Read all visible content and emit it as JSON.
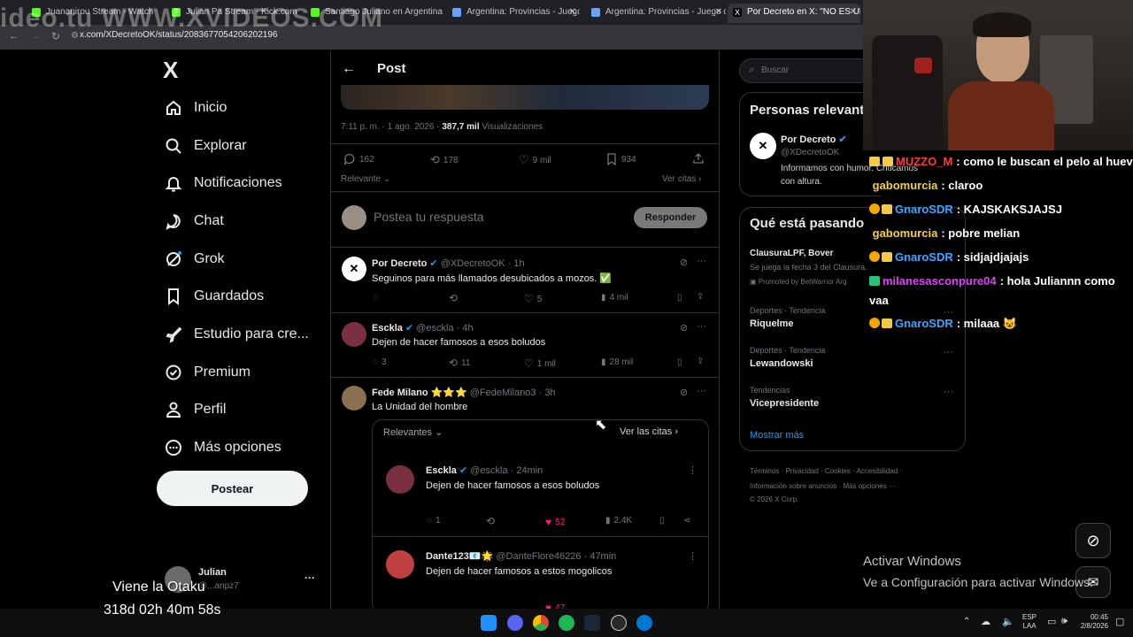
{
  "browser": {
    "watermark": "ideo.tu WWW.XVIDEOS.COM",
    "tabs": [
      {
        "label": "Juananirou Stream - Watch",
        "color": "#53fc18"
      },
      {
        "label": "Julian Pa Stream - Kick.com",
        "color": "#53fc18"
      },
      {
        "label": "Santiago Juliano en Argentina",
        "color": "#53fc18"
      },
      {
        "label": "Argentina: Provincias - Juego d",
        "color": "#6aa3ff"
      },
      {
        "label": "Argentina: Provincias - Juego d",
        "color": "#6aa3ff"
      },
      {
        "label": "Por Decreto en X: \"NO ES UN",
        "color": "#ffffff"
      }
    ],
    "url": "x.com/XDecretoOK/status/2083677054206202196"
  },
  "nav": {
    "logo": "X",
    "items": [
      {
        "label": "Inicio",
        "icon": "home-icon"
      },
      {
        "label": "Explorar",
        "icon": "search-icon"
      },
      {
        "label": "Notificaciones",
        "icon": "bell-icon"
      },
      {
        "label": "Chat",
        "icon": "chat-icon"
      },
      {
        "label": "Grok",
        "icon": "grok-icon"
      },
      {
        "label": "Guardados",
        "icon": "bookmark-icon"
      },
      {
        "label": "Estudio para cre...",
        "icon": "rocket-icon"
      },
      {
        "label": "Premium",
        "icon": "premium-icon"
      },
      {
        "label": "Perfil",
        "icon": "person-icon"
      },
      {
        "label": "Más opciones",
        "icon": "more-icon"
      }
    ],
    "post_button": "Postear",
    "account_name": "Julian",
    "account_handle": "@...anpz7",
    "more": "···"
  },
  "post": {
    "header_title": "Post",
    "timestamp": "7:11 p. m. · 1 ago. 2026 ·",
    "views_count": "387,7 mil",
    "views_label": "Visualizaciones",
    "replies": "162",
    "reposts": "178",
    "likes": "9 mil",
    "bookmarks": "934",
    "sort_label": "Relevante",
    "quotes_link": "Ver citas",
    "reply_placeholder": "Postea tu respuesta",
    "reply_button": "Responder"
  },
  "replies": [
    {
      "name": "Por Decreto",
      "handle": "@XDecretoOK · 1h",
      "text": "Seguinos para más llamados desubicados a mozos. ✅",
      "replies": "",
      "reposts": "",
      "likes": "5",
      "views": "4 mil"
    },
    {
      "name": "Esckla",
      "handle": "@esckla · 4h",
      "text": "Dejen de hacer famosos a esos boludos",
      "replies": "3",
      "reposts": "11",
      "likes": "1 mil",
      "views": "28 mil"
    },
    {
      "name": "Fede Milano ⭐⭐⭐",
      "handle": "@FedeMilano3 · 3h",
      "text": "La Unidad del hombre"
    }
  ],
  "quote_panel": {
    "sort_label": "Relevantes",
    "quotes_link": "Ver las citas",
    "items": [
      {
        "name": "Esckla",
        "handle": "@esckla · 24min",
        "text": "Dejen de hacer famosos a esos boludos",
        "replies": "1",
        "likes": "52",
        "views": "2.4K"
      },
      {
        "name": "Dante123📧🌟",
        "handle": "@DanteFlore46226 · 47min",
        "text": "Dejen de hacer famosos a estos mogolicos",
        "likes": "47"
      }
    ]
  },
  "sidebar": {
    "search_placeholder": "Buscar",
    "relevant_title": "Personas relevant",
    "relevant_person": {
      "name": "Por Decreto",
      "handle": "@XDecretoOK",
      "bio_line1": "Informamos con humor. Criticamos",
      "bio_line2": "con altura."
    },
    "trends_title": "Qué está pasando",
    "promoted": {
      "name": "ClausuraLPF, Bover",
      "desc": "Se juega la fecha 3 del Clausura.",
      "label": "Promoted by BetWarrior Arg"
    },
    "trends": [
      {
        "category": "Deportes · Tendencia",
        "name": "Riquelme"
      },
      {
        "category": "Deportes · Tendencia",
        "name": "Lewandowski"
      },
      {
        "category": "Tendencias",
        "name": "Vicepresidente"
      }
    ],
    "show_more": "Mostrar más",
    "footer_line1": [
      "Términos",
      "Privacidad",
      "Cookies",
      "Accesibilidad"
    ],
    "footer_line2a": "Información sobre anuncios",
    "footer_line2b": "Más opciones ···",
    "copyright": "© 2026 X Corp."
  },
  "stream": {
    "chat": [
      {
        "user": "MUZZO_M",
        "color": "#ff3b3b",
        "msg": ": como le buscan el pelo al huev",
        "badges": 2
      },
      {
        "user": "gabomurcia",
        "color": "#f4d03f",
        "msg": ": claroo",
        "badges": 0
      },
      {
        "user": "GnaroSDR",
        "color": "#3ea6ff",
        "msg": ": KAJSKAKSJAJSJ",
        "badges": 2
      },
      {
        "user": "gabomurcia",
        "color": "#f4d03f",
        "msg": ": pobre melian",
        "badges": 0
      },
      {
        "user": "GnaroSDR",
        "color": "#3ea6ff",
        "msg": ": sidjajdjajajs",
        "badges": 2
      },
      {
        "user": "milanesasconpure04",
        "color": "#e040fb",
        "msg": ": hola Juliannn como",
        "badges": 1
      },
      {
        "user": "",
        "color": "#ffffff",
        "msg": "vaa",
        "badges": 0
      },
      {
        "user": "GnaroSDR",
        "color": "#3ea6ff",
        "msg": ": milaaa 😺",
        "badges": 2
      }
    ],
    "overlay_title": "Viene la Otaku",
    "countdown": "318d 02h 40m 58s"
  },
  "windows": {
    "activate_title": "Activar Windows",
    "activate_desc": "Ve a Configuración para activar Windows.",
    "lang": "ESP",
    "layout": "LAA",
    "time": "00:45",
    "date": "2/8/2026"
  },
  "colors": {
    "accent": "#1d9bf0",
    "like_pink": "#f91880",
    "bg": "#000000",
    "border": "#2f3336"
  }
}
